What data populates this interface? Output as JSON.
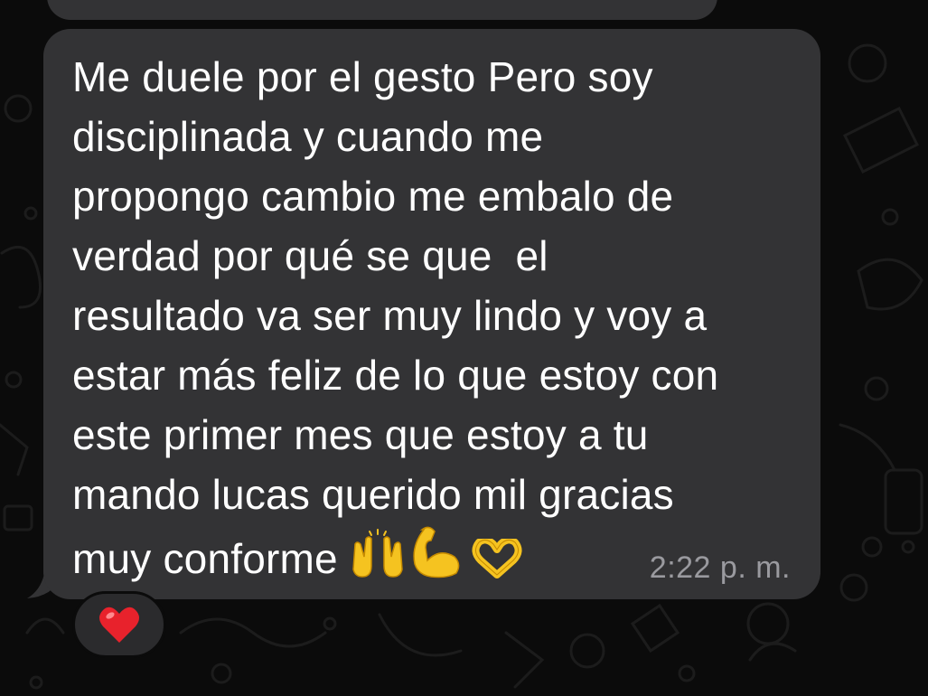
{
  "conversation": {
    "message": {
      "text": "Me duele por el gesto Pero soy\ndisciplinada y cuando me\npropongo cambio me embalo de\nverdad por qué se que  el\nresultado va ser muy lindo y voy a\nestar más feliz de lo que estoy con\neste primer mes que estoy a tu\nmando lucas querido mil gracias\nmuy conforme ",
      "emojis": [
        "raising-hands-icon",
        "flexed-biceps-icon",
        "heart-hands-icon"
      ],
      "timestamp": "2:22 p. m.",
      "reaction": "heart-icon"
    }
  },
  "colors": {
    "background": "#0b0b0b",
    "bubble": "#333335",
    "text": "#ffffff",
    "timestamp": "#9a9a9f",
    "emoji_yellow": "#f5c320",
    "heart_red": "#e8222c"
  }
}
